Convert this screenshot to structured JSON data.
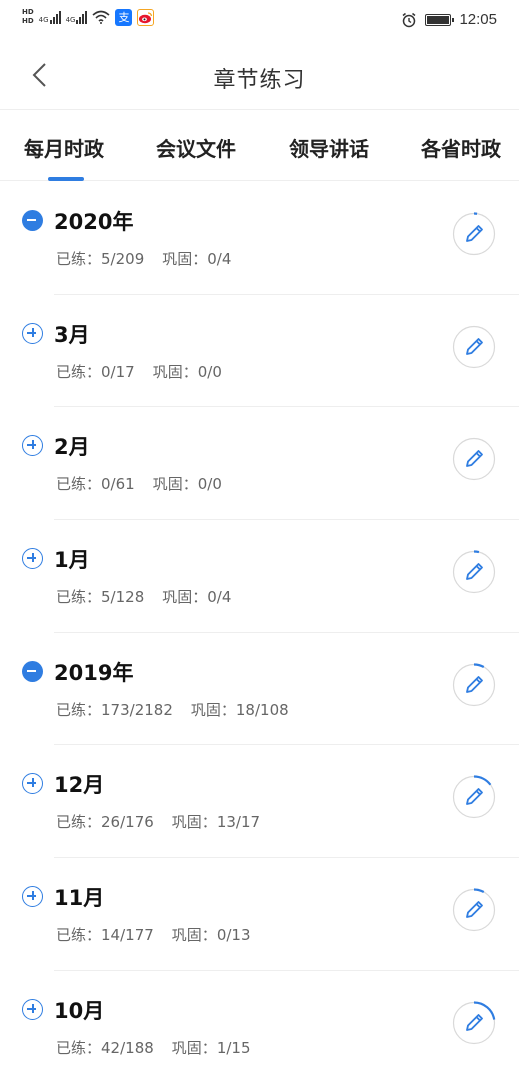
{
  "status_bar": {
    "sim_labels": [
      "HD",
      "HD"
    ],
    "network": [
      "4G",
      "4G"
    ],
    "time": "12:05",
    "icons": [
      "hd-icon",
      "signal-icon",
      "wifi-icon",
      "alipay-icon",
      "weibo-icon",
      "alarm-icon",
      "battery-icon"
    ]
  },
  "header": {
    "title": "章节练习",
    "back_icon": "chevron-left-icon"
  },
  "tabs": [
    {
      "label": "每月时政",
      "active": true
    },
    {
      "label": "会议文件",
      "active": false
    },
    {
      "label": "领导讲话",
      "active": false
    },
    {
      "label": "各省时政",
      "active": false
    }
  ],
  "accent_color": "#2f7de1",
  "list": [
    {
      "title": "2020年",
      "practiced_label": "已练：",
      "practiced": "5/209",
      "review_label": "巩固：",
      "review": "0/4",
      "expanded": true,
      "progress": 0.024
    },
    {
      "title": "3月",
      "practiced_label": "已练：",
      "practiced": "0/17",
      "review_label": "巩固：",
      "review": "0/0",
      "expanded": false,
      "progress": 0
    },
    {
      "title": "2月",
      "practiced_label": "已练：",
      "practiced": "0/61",
      "review_label": "巩固：",
      "review": "0/0",
      "expanded": false,
      "progress": 0
    },
    {
      "title": "1月",
      "practiced_label": "已练：",
      "practiced": "5/128",
      "review_label": "巩固：",
      "review": "0/4",
      "expanded": false,
      "progress": 0.039
    },
    {
      "title": "2019年",
      "practiced_label": "已练：",
      "practiced": "173/2182",
      "review_label": "巩固：",
      "review": "18/108",
      "expanded": true,
      "progress": 0.079
    },
    {
      "title": "12月",
      "practiced_label": "已练：",
      "practiced": "26/176",
      "review_label": "巩固：",
      "review": "13/17",
      "expanded": false,
      "progress": 0.148
    },
    {
      "title": "11月",
      "practiced_label": "已练：",
      "practiced": "14/177",
      "review_label": "巩固：",
      "review": "0/13",
      "expanded": false,
      "progress": 0.079
    },
    {
      "title": "10月",
      "practiced_label": "已练：",
      "practiced": "42/188",
      "review_label": "巩固：",
      "review": "1/15",
      "expanded": false,
      "progress": 0.223
    }
  ]
}
